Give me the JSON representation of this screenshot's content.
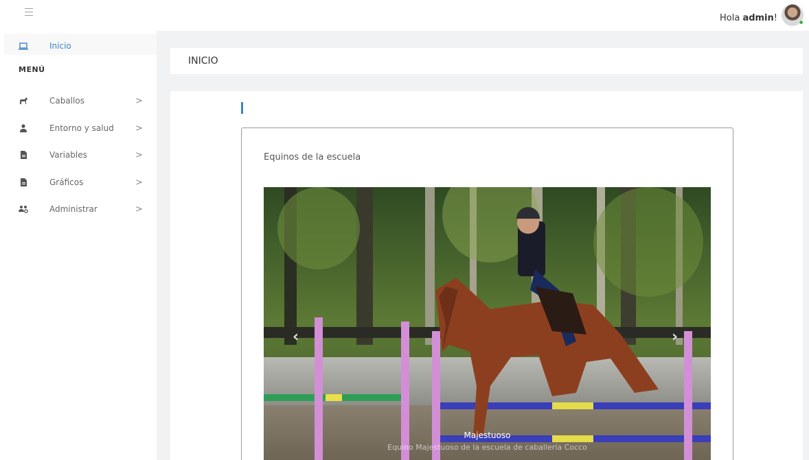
{
  "header": {
    "greeting_prefix": "Hola ",
    "user": "admin",
    "greeting_suffix": "!"
  },
  "sidebar": {
    "active_item": {
      "icon": "laptop-icon",
      "label": "Inicio"
    },
    "menu_heading": "MENÚ",
    "items": [
      {
        "icon": "horse-icon",
        "label": "Caballos",
        "chevron": ">"
      },
      {
        "icon": "user-doctor-icon",
        "label": "Entorno y salud",
        "chevron": ">"
      },
      {
        "icon": "file-icon",
        "label": "Variables",
        "chevron": ">"
      },
      {
        "icon": "file-icon",
        "label": "Gráficos",
        "chevron": ">"
      },
      {
        "icon": "users-cog-icon",
        "label": "Administrar",
        "chevron": ">"
      }
    ]
  },
  "page": {
    "title": "INICIO"
  },
  "card": {
    "title": "Equinos de la escuela",
    "carousel": {
      "caption_title": "Majestuoso",
      "caption_text": "Equino Majestuoso de la escuela de caballería Cocco"
    }
  },
  "colors": {
    "accent": "#3a82c4",
    "online": "#3bb04a"
  }
}
